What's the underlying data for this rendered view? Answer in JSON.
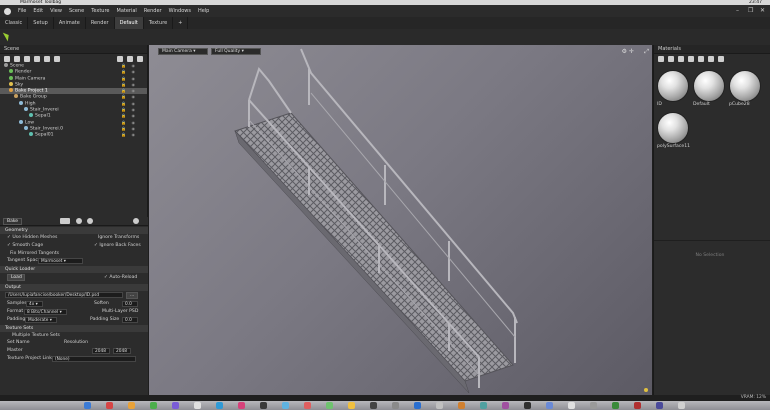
{
  "os_bar": {
    "app_name": "Marmoset Toolbag",
    "time": "23:47"
  },
  "menu": [
    "File",
    "Edit",
    "View",
    "Scene",
    "Texture",
    "Material",
    "Render",
    "Windows",
    "Help"
  ],
  "tabs": [
    {
      "label": "Classic",
      "active": false
    },
    {
      "label": "Setup",
      "active": false
    },
    {
      "label": "Animate",
      "active": false
    },
    {
      "label": "Render",
      "active": false
    },
    {
      "label": "Default",
      "active": true
    },
    {
      "label": "Texture",
      "active": false
    },
    {
      "label": "+",
      "active": false
    }
  ],
  "scene": {
    "title": "Scene",
    "tree": [
      {
        "label": "Scene",
        "indent": 0,
        "selected": false,
        "color": "#9a9a9a"
      },
      {
        "label": "Render",
        "indent": 1,
        "selected": false,
        "color": "#6bbf59"
      },
      {
        "label": "Main Camera",
        "indent": 1,
        "selected": false,
        "color": "#6bbf59"
      },
      {
        "label": "Sky",
        "indent": 1,
        "selected": false,
        "color": "#e0c050"
      },
      {
        "label": "Bake Project 1",
        "indent": 1,
        "selected": true,
        "color": "#e0a040"
      },
      {
        "label": "Bake Group",
        "indent": 2,
        "selected": false,
        "color": "#c8a060"
      },
      {
        "label": "High",
        "indent": 3,
        "selected": false,
        "color": "#8fbcd8"
      },
      {
        "label": "Stair_Inverei",
        "indent": 4,
        "selected": false,
        "color": "#8fbcd8"
      },
      {
        "label": "Sepal1",
        "indent": 5,
        "selected": false,
        "color": "#5fc0b0"
      },
      {
        "label": "Low",
        "indent": 3,
        "selected": false,
        "color": "#8fbcd8"
      },
      {
        "label": "Stair_Inverei.0",
        "indent": 4,
        "selected": false,
        "color": "#8fbcd8"
      },
      {
        "label": "Sepal01",
        "indent": 5,
        "selected": false,
        "color": "#5fc0b0"
      }
    ]
  },
  "bake": {
    "title": "Bake",
    "geometry": "Geometry",
    "use_hidden_meshes": "Use Hidden Meshes",
    "ignore_transforms": "Ignore Transforms",
    "smooth_cage": "Smooth Cage",
    "ignore_back_faces": "Ignore Back Faces",
    "fix_mirrored": "Fix Mirrored Tangents",
    "tangent_space_label": "Tangent Space",
    "tangent_space_value": "Marmoset",
    "quick_loader": "Quick Loader",
    "load": "Load",
    "auto_reload": "Auto-Reload",
    "output": "Output",
    "output_path": "/Users/lupiafancise/booker/Desktop/ID.psd",
    "browse": "...",
    "samples_label": "Samples",
    "samples_value": "4x",
    "soften_label": "Soften",
    "soften_value": "0.0",
    "format_label": "Format",
    "format_value": "8 Bits/Channel",
    "multilayer": "Multi-Layer PSD",
    "padding_label": "Padding",
    "padding_value": "Moderate",
    "padding_size_label": "Padding Size",
    "padding_size_value": "0.0",
    "texture_sets": "Texture Sets",
    "multiple_sets": "Multiple Texture Sets",
    "set_name": "Set Name",
    "resolution": "Resolution",
    "master": "Master",
    "res_w": "2048",
    "res_h": "2048",
    "texture_project_link": "Texture Project Link",
    "link_value": "(None)"
  },
  "viewport": {
    "camera": "Main Camera",
    "quality": "Full Quality"
  },
  "materials": {
    "title": "Materials",
    "items": [
      "ID",
      "Default",
      "pCube28",
      "polySurface11"
    ],
    "no_selection": "No Selection"
  },
  "status": {
    "vram": "VRAM: 12%"
  }
}
